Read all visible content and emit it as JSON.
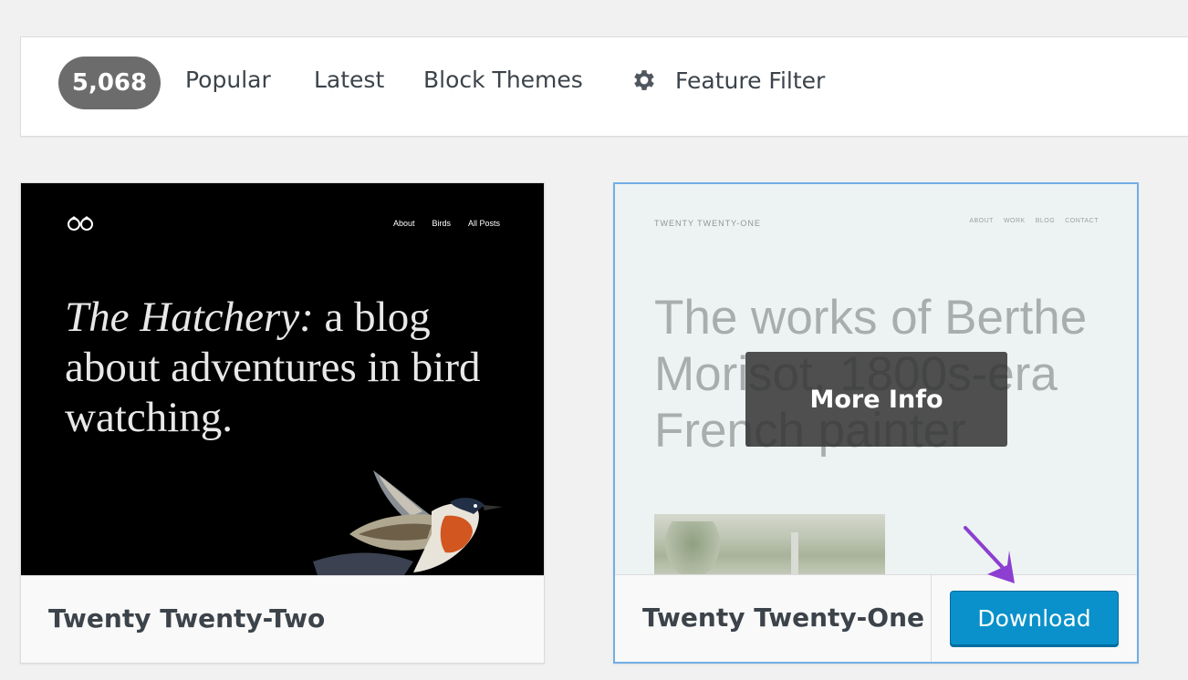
{
  "filter_bar": {
    "count": "5,068",
    "links": [
      "Popular",
      "Latest",
      "Block Themes"
    ],
    "feature_filter_label": "Feature Filter",
    "feature_filter_icon": "gear-icon"
  },
  "themes": [
    {
      "name": "Twenty Twenty-Two",
      "preview": {
        "nav": [
          "About",
          "Birds",
          "All Posts"
        ],
        "title_italic": "The Hatchery:",
        "title_rest": " a blog about adventures in bird watching."
      }
    },
    {
      "name": "Twenty Twenty-One",
      "preview": {
        "site_title": "TWENTY TWENTY-ONE",
        "nav": [
          "ABOUT",
          "WORK",
          "BLOG",
          "CONTACT"
        ],
        "title": "The works of Berthe Morisot, 1800s-era French painter"
      },
      "more_info_label": "More Info",
      "download_label": "Download"
    }
  ],
  "colors": {
    "accent": "#0a91cb",
    "badge": "#6c6c6c",
    "annotation_arrow": "#8c3fd0",
    "selected_border": "#72aee6"
  }
}
